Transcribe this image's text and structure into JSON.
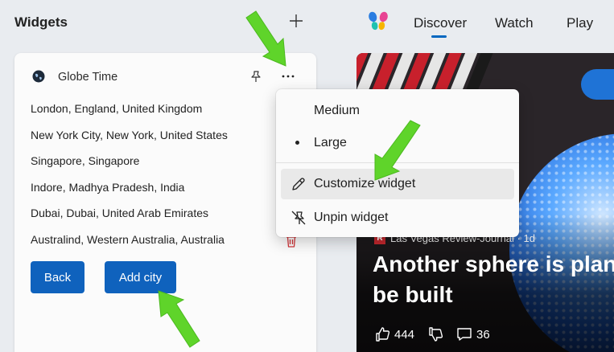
{
  "panel": {
    "title": "Widgets",
    "add_icon": "plus-icon"
  },
  "feed": {
    "logo_icon": "copilot-logo",
    "tabs": [
      {
        "label": "Discover",
        "active": true
      },
      {
        "label": "Watch"
      },
      {
        "label": "Play"
      }
    ]
  },
  "widget": {
    "title": "Globe Time",
    "icon": "globe-icon",
    "cities": [
      "London, England, United Kingdom",
      "New York City, New York, United States",
      "Singapore, Singapore",
      "Indore, Madhya Pradesh, India",
      "Dubai, Dubai, United Arab Emirates",
      "Australind, Western Australia, Australia"
    ],
    "back_label": "Back",
    "add_city_label": "Add city"
  },
  "menu": {
    "items": [
      {
        "label": "Medium"
      },
      {
        "label": "Large",
        "selected": true
      },
      {
        "label": "Customize widget",
        "icon": "pencil-icon",
        "hovered": true
      },
      {
        "label": "Unpin widget",
        "icon": "unpin-icon"
      }
    ]
  },
  "news": {
    "source": "Las Vegas Review-Journal · 1d",
    "source_logo": "R",
    "headline_line1": "Another sphere is plan",
    "headline_line2": "be built",
    "likes": "444",
    "comments": "36"
  },
  "colors": {
    "accent": "#0067c0",
    "button": "#0f62bd",
    "annotation_arrow": "#5fd42a",
    "trash": "#d13438"
  }
}
